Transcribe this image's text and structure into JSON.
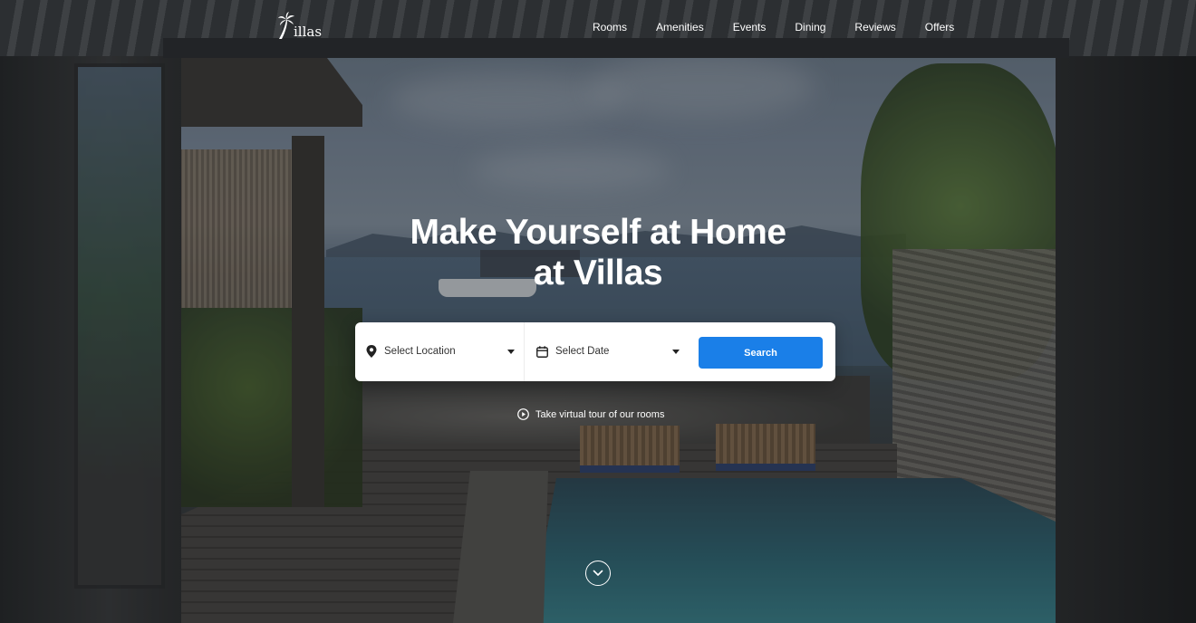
{
  "brand": {
    "logo_text": "illas",
    "logo_icon": "palm-tree-icon"
  },
  "nav": {
    "items": [
      {
        "label": "Rooms"
      },
      {
        "label": "Amenities"
      },
      {
        "label": "Events"
      },
      {
        "label": "Dining"
      },
      {
        "label": "Reviews"
      },
      {
        "label": "Offers"
      }
    ]
  },
  "hero": {
    "title_line1": "Make Yourself at Home",
    "title_line2": "at Villas"
  },
  "search": {
    "location_placeholder": "Select Location",
    "location_icon": "map-pin-icon",
    "date_placeholder": "Select Date",
    "date_icon": "calendar-icon",
    "button_label": "Search",
    "button_color": "#1a7fe8"
  },
  "tour": {
    "label": "Take virtual tour of our rooms",
    "icon": "play-circle-icon"
  },
  "scroll": {
    "icon": "chevron-down-icon"
  }
}
